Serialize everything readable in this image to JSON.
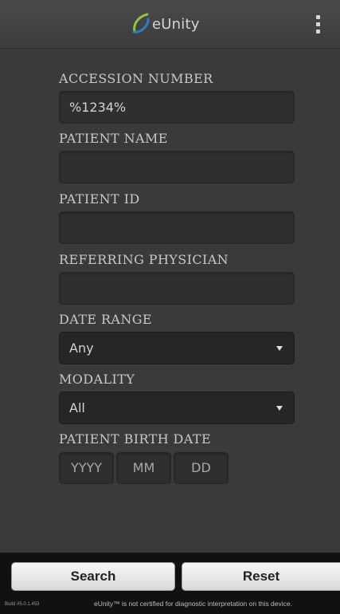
{
  "header": {
    "app_name": "eUnity",
    "logo_icon": "eunity-logo-icon",
    "menu_icon": "overflow-menu-icon"
  },
  "form": {
    "accession": {
      "label": "ACCESSION NUMBER",
      "value": "%1234%"
    },
    "patient_name": {
      "label": "PATIENT NAME",
      "value": ""
    },
    "patient_id": {
      "label": "PATIENT ID",
      "value": ""
    },
    "referring_physician": {
      "label": "REFERRING PHYSICIAN",
      "value": ""
    },
    "date_range": {
      "label": "DATE RANGE",
      "selected": "Any"
    },
    "modality": {
      "label": "MODALITY",
      "selected": "All"
    },
    "birth_date": {
      "label": "PATIENT BIRTH DATE",
      "year_placeholder": "YYYY",
      "month_placeholder": "MM",
      "day_placeholder": "DD"
    }
  },
  "actions": {
    "search_label": "Search",
    "reset_label": "Reset"
  },
  "footer": {
    "build": "Build #5.0.1.453",
    "notice": "eUnity™ is not certified for diagnostic interpretation on this device."
  },
  "colors": {
    "background": "#3a3a3a",
    "field": "#2f2f2f",
    "label": "#c8c8c8",
    "bottom_bar": "#111111",
    "logo_green": "#8cc63f",
    "logo_blue": "#2a7fc0"
  }
}
